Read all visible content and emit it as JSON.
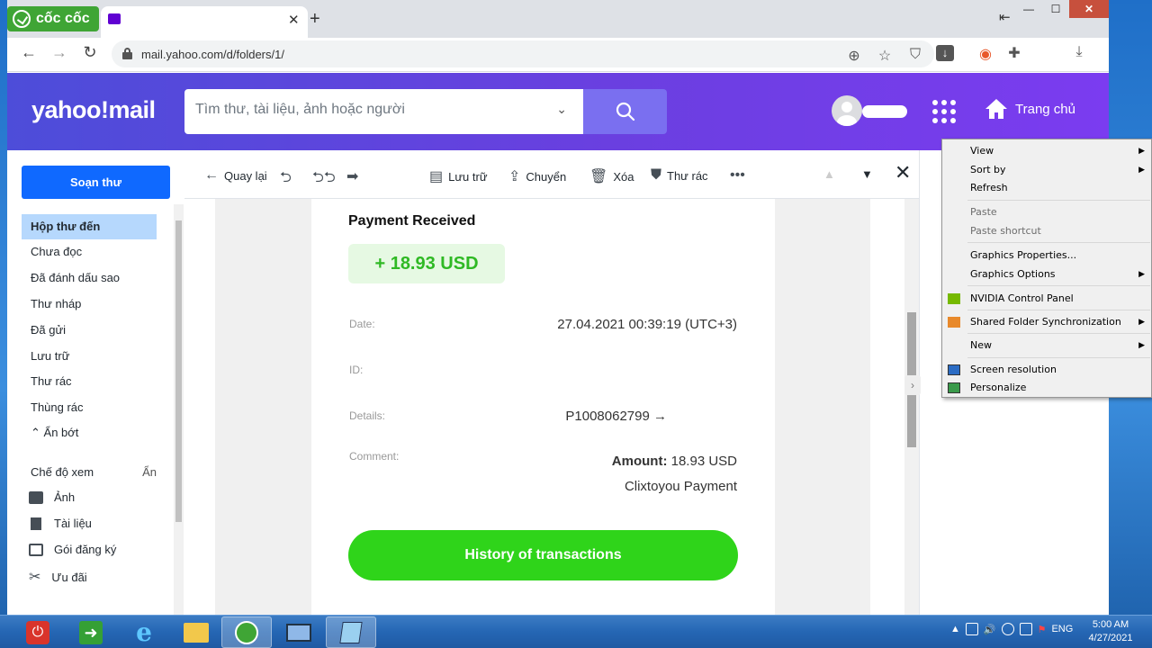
{
  "browser": {
    "brand": "cốc cốc",
    "url": "mail.yahoo.com/d/folders/1/"
  },
  "yahoo": {
    "logo": "yahoo!mail",
    "search_placeholder": "Tìm thư, tài liệu, ảnh hoặc người",
    "home_label": "Trang chủ"
  },
  "sidebar": {
    "compose": "Soạn thư",
    "folders": [
      "Hộp thư đến",
      "Chưa đọc",
      "Đã đánh dấu sao",
      "Thư nháp",
      "Đã gửi",
      "Lưu trữ",
      "Thư rác",
      "Thùng rác"
    ],
    "collapse": "Ẩn bớt",
    "views_label": "Chế độ xem",
    "views_hide": "Ẩn",
    "views": [
      "Ảnh",
      "Tài liệu",
      "Gói đăng ký",
      "Ưu đãi"
    ]
  },
  "mailbar": {
    "back": "Quay lại",
    "archive": "Lưu trữ",
    "move": "Chuyển",
    "delete": "Xóa",
    "spam": "Thư rác"
  },
  "email": {
    "title": "Payment Received",
    "amount": "+ 18.93 USD",
    "date_label": "Date:",
    "date_value": "27.04.2021 00:39:19 (UTC+3)",
    "id_label": "ID:",
    "details_label": "Details:",
    "details_value": "P1008062799 →",
    "comment_label": "Comment:",
    "amount_label": "Amount:",
    "amount_value": " 18.93 USD",
    "comment_value": "Clixtoyou Payment",
    "history_button": "History of transactions"
  },
  "context_menu": {
    "items": [
      "View",
      "Sort by",
      "Refresh",
      "Paste",
      "Paste shortcut",
      "Graphics Properties...",
      "Graphics Options",
      "NVIDIA Control Panel",
      "Shared Folder Synchronization",
      "New",
      "Screen resolution",
      "Personalize"
    ]
  },
  "taskbar": {
    "lang": "ENG",
    "time": "5:00 AM",
    "date": "4/27/2021"
  },
  "colors": {
    "yahoo_purple": "#6a3fe0",
    "compose_blue": "#0f69ff",
    "payment_green": "#2fd41a",
    "windows_taskbar": "#2566b4"
  }
}
